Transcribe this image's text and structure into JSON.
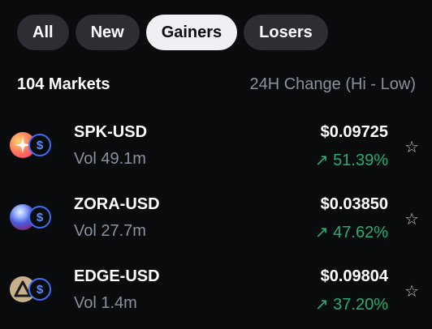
{
  "tabs": [
    "All",
    "New",
    "Gainers",
    "Losers"
  ],
  "active_tab": "Gainers",
  "header": {
    "count": "104 Markets",
    "sort": "24H Change (Hi - Low)"
  },
  "markets": [
    {
      "pair": "SPK-USD",
      "vol": "Vol 49.1m",
      "price": "$0.09725",
      "change": "51.39%",
      "icon": "spk-coin-icon"
    },
    {
      "pair": "ZORA-USD",
      "vol": "Vol 27.7m",
      "price": "$0.03850",
      "change": "47.62%",
      "icon": "zora-coin-icon"
    },
    {
      "pair": "EDGE-USD",
      "vol": "Vol 1.4m",
      "price": "$0.09804",
      "change": "37.20%",
      "icon": "edge-coin-icon"
    }
  ],
  "usd_symbol": "$",
  "up_arrow": "↗",
  "star_glyph": "☆",
  "colors": {
    "background": "#0a0b0d",
    "positive": "#27ad75",
    "muted": "#8a919e",
    "usd_blue": "#3d6ef5"
  }
}
